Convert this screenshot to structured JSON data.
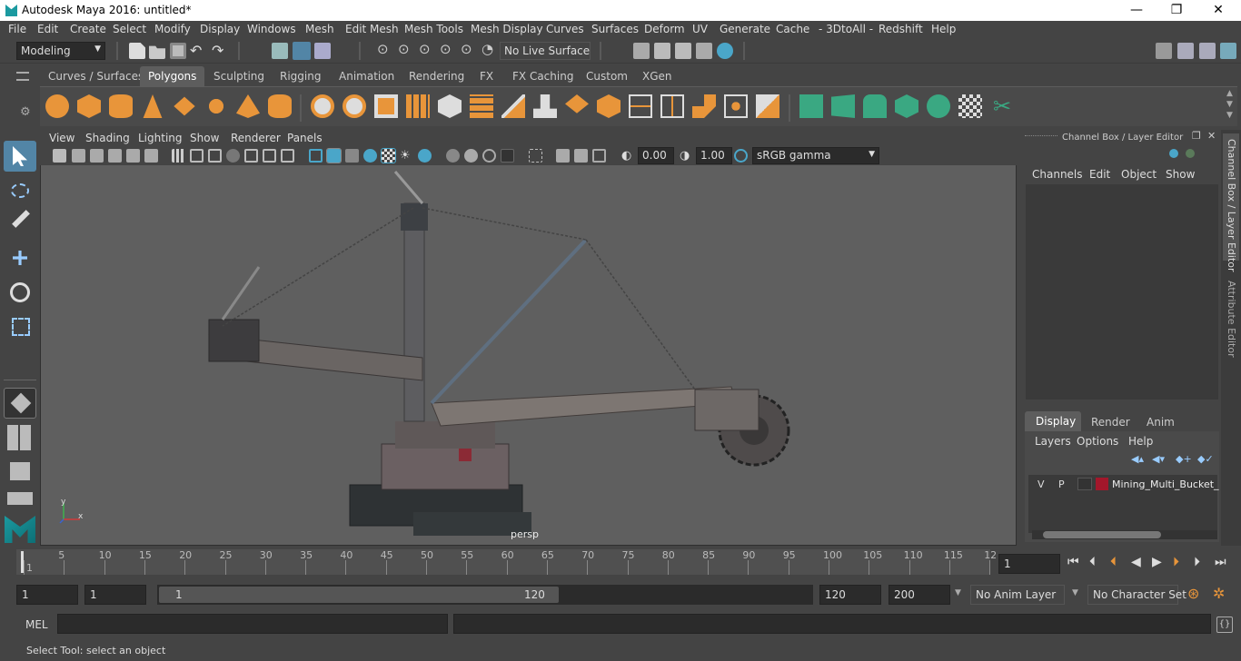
{
  "window": {
    "title": "Autodesk Maya 2016: untitled*",
    "minimize": "—",
    "restore": "❐",
    "close": "✕"
  },
  "menus": [
    "File",
    "Edit",
    "Create",
    "Select",
    "Modify",
    "Display",
    "Windows",
    "Mesh",
    "Edit Mesh",
    "Mesh Tools",
    "Mesh Display",
    "Curves",
    "Surfaces",
    "Deform",
    "UV",
    "Generate",
    "Cache",
    "- 3DtoAll -",
    "Redshift",
    "Help"
  ],
  "toolbar": {
    "mode": "Modeling",
    "live_surface": "No Live Surface"
  },
  "shelf_tabs": [
    "Curves / Surfaces",
    "Polygons",
    "Sculpting",
    "Rigging",
    "Animation",
    "Rendering",
    "FX",
    "FX Caching",
    "Custom",
    "XGen"
  ],
  "shelf_active": "Polygons",
  "viewport": {
    "menus": [
      "View",
      "Shading",
      "Lighting",
      "Show",
      "Renderer",
      "Panels"
    ],
    "exposure": "0.00",
    "gamma": "1.00",
    "color_space": "sRGB gamma",
    "camera_label": "persp",
    "axis_x": "x",
    "axis_y": "y"
  },
  "channel_box": {
    "title": "Channel Box / Layer Editor",
    "menus": [
      "Channels",
      "Edit",
      "Object",
      "Show"
    ]
  },
  "layer_editor": {
    "tabs": [
      "Display",
      "Render",
      "Anim"
    ],
    "active_tab": "Display",
    "menus": [
      "Layers",
      "Options",
      "Help"
    ],
    "layer": {
      "v": "V",
      "p": "P",
      "name": "Mining_Multi_Bucket_",
      "color": "#a3172b"
    }
  },
  "side_tabs": [
    "Channel Box / Layer Editor",
    "Attribute Editor"
  ],
  "timeline": {
    "ticks": [
      "1",
      "5",
      "10",
      "15",
      "20",
      "25",
      "30",
      "35",
      "40",
      "45",
      "50",
      "55",
      "60",
      "65",
      "70",
      "75",
      "80",
      "85",
      "90",
      "95",
      "100",
      "105",
      "110",
      "115",
      "12"
    ],
    "current_frame": "1"
  },
  "range": {
    "start": "1",
    "playback_start": "1",
    "slider_start": "1",
    "slider_end": "120",
    "playback_end": "120",
    "end": "200",
    "anim_layer": "No Anim Layer",
    "character_set": "No Character Set"
  },
  "mel": {
    "label": "MEL"
  },
  "status": {
    "message": "Select Tool: select an object"
  },
  "colors": {
    "accent": "#5285a6",
    "shelf_orange": "#e8953a",
    "shelf_green": "#3aa882",
    "layer_color": "#a3172b"
  }
}
